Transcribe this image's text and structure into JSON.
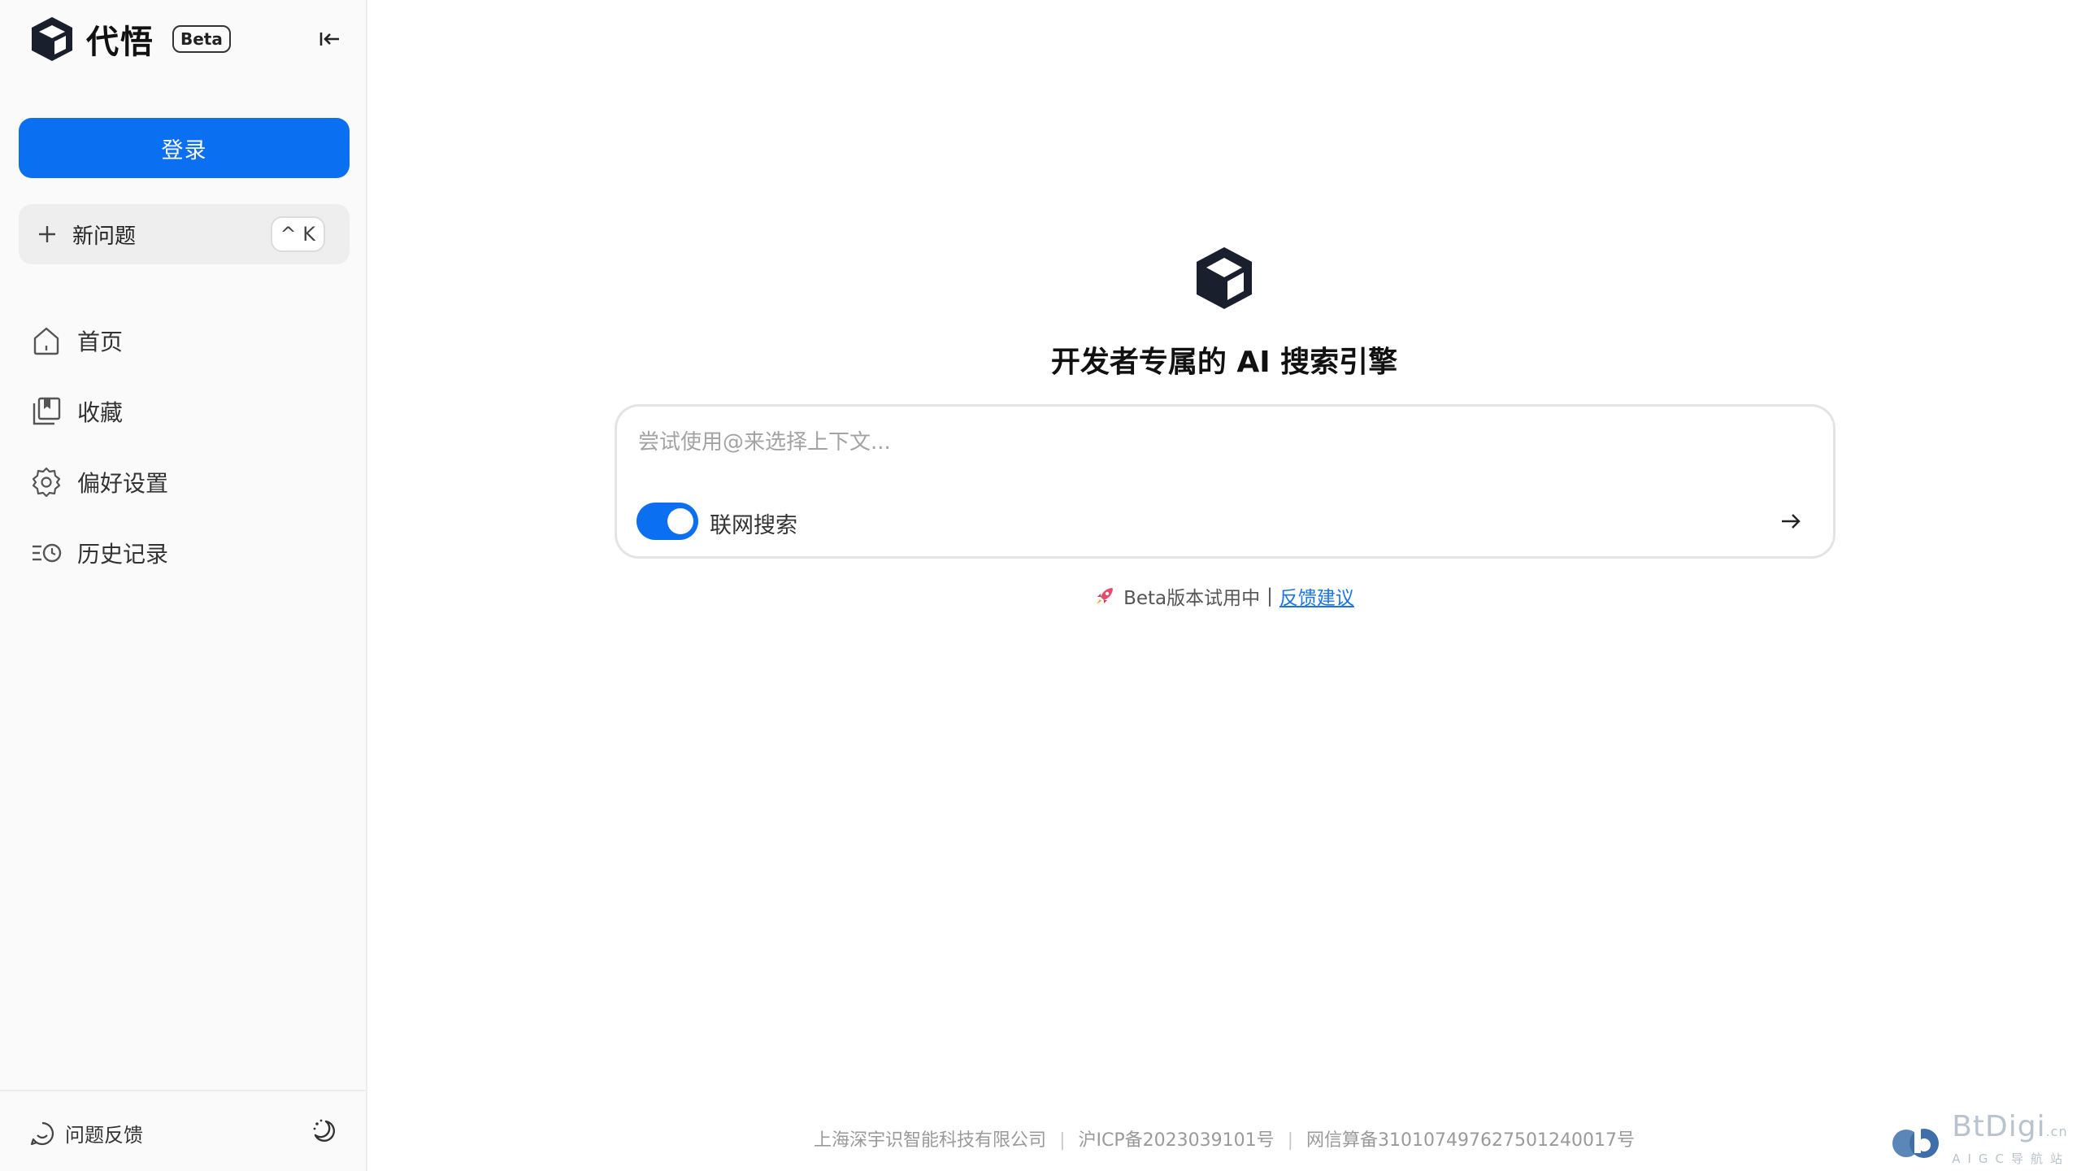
{
  "sidebar": {
    "brand_name": "代悟",
    "brand_badge": "Beta",
    "login_label": "登录",
    "new_question_label": "新问题",
    "new_question_shortcut": "^ K",
    "nav": [
      {
        "label": "首页",
        "icon": "home-icon"
      },
      {
        "label": "收藏",
        "icon": "bookmark-icon"
      },
      {
        "label": "偏好设置",
        "icon": "gear-icon"
      },
      {
        "label": "历史记录",
        "icon": "history-icon"
      }
    ],
    "feedback_label": "问题反馈"
  },
  "main": {
    "title": "开发者专属的 AI 搜索引擎",
    "search_placeholder": "尝试使用@来选择上下文...",
    "web_search_label": "联网搜索",
    "web_search_enabled": true,
    "beta_note": "Beta版本试用中",
    "beta_separator": "|",
    "feedback_link": "反馈建议"
  },
  "footer": {
    "company": "上海深宇识智能科技有限公司",
    "icp": "沪ICP备2023039101号",
    "algo": "网信算备310107497627501240017号"
  },
  "watermark": {
    "name": "BtDigi",
    "suffix": ".cn",
    "sub": "AIGC导航站"
  },
  "colors": {
    "accent": "#0b6ff2",
    "sidebar_bg": "#fafafa",
    "link": "#1a73e8"
  }
}
